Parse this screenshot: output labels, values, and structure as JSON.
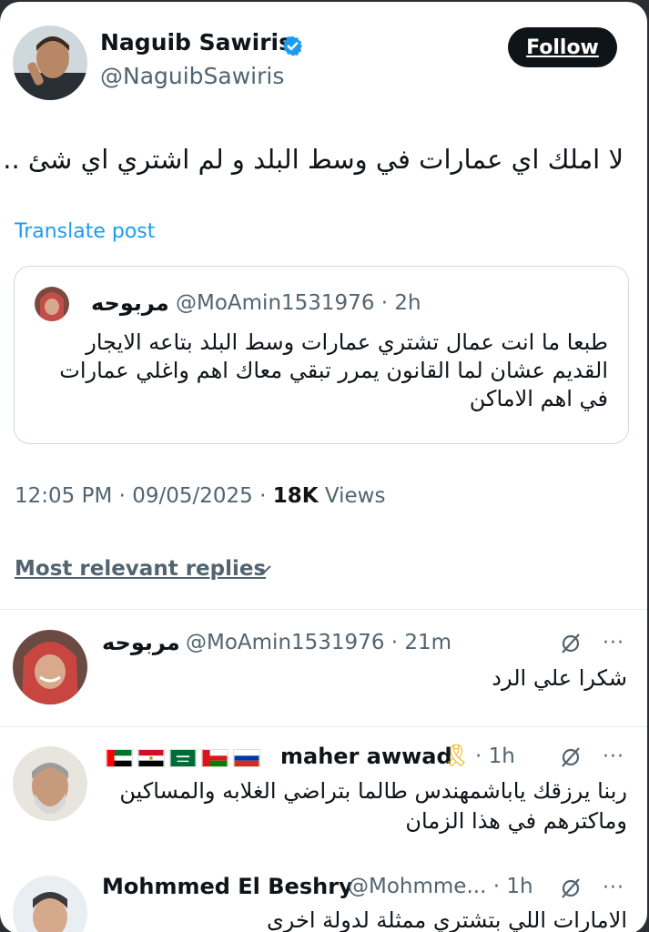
{
  "post": {
    "author_name": "Naguib Sawiris",
    "author_handle": "@NaguibSawiris",
    "follow_label": "Follow",
    "text": "لا املك اي عمارات في وسط البلد و لم اشتري اي شئ ..",
    "translate_label": "Translate post",
    "timestamp": "12:05 PM · 09/05/2025 ·",
    "views_count": "18K",
    "views_label": "Views"
  },
  "quote": {
    "author_name": "مربوحه",
    "author_meta": "@MoAmin1531976 · 2h",
    "lines": [
      "طبعا ما انت عمال تشتري عمارات وسط البلد بتاعه الايجار",
      "القديم عشان لما القانون يمرر تبقي معاك اهم واغلي عمارات",
      "في اهم الاماكن"
    ]
  },
  "replies_header": {
    "label": "Most relevant replies"
  },
  "replies": [
    {
      "name": "مربوحه",
      "meta": "@MoAmin1531976 · 21m",
      "lines": [
        "شكرا علي الرد"
      ]
    },
    {
      "name": "maher awwad",
      "ribbon": "🎗",
      "meta": "· 1h",
      "lines": [
        "ربنا يرزقك ياباشمهندس طالما بتراضي الغلابه والمساكين",
        "وماكترهم في هذا الزمان"
      ]
    },
    {
      "name": "Mohmmed El Beshry",
      "meta": "@Mohmme... · 1h",
      "lines": [
        "الامارات اللي بتشتري ممثلة لدولة اخرى"
      ]
    }
  ],
  "icons": {
    "verified": "verified-badge-icon",
    "grok": "grok-icon",
    "more": "more-options-icon",
    "chevron": "chevron-down-icon"
  },
  "colors": {
    "link": "#1d9bf0",
    "text": "#0f1419",
    "secondary": "#536471",
    "border": "#cfd9de"
  }
}
